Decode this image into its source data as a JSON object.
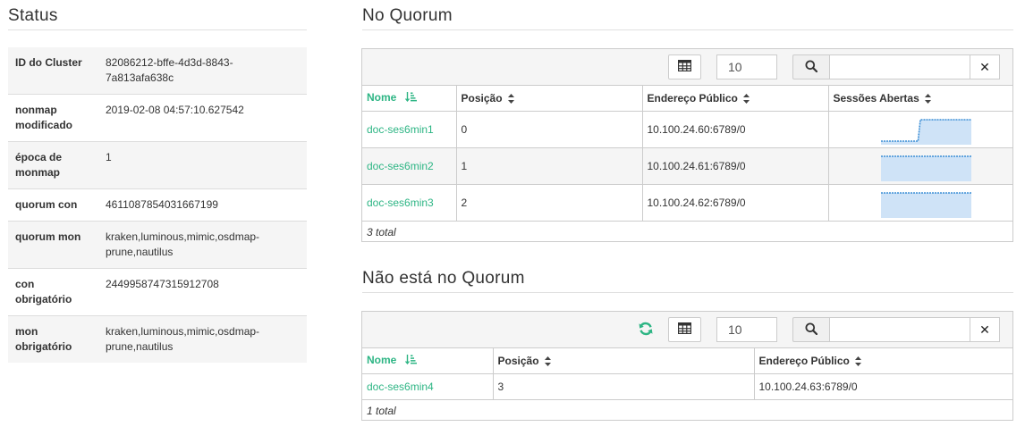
{
  "status": {
    "title": "Status",
    "rows": [
      {
        "key": "ID do Cluster",
        "value": "82086212-bffe-4d3d-8843-7a813afa638c"
      },
      {
        "key": "nonmap modificado",
        "value": "2019-02-08 04:57:10.627542"
      },
      {
        "key": "época de monmap",
        "value": "1"
      },
      {
        "key": "quorum con",
        "value": "4611087854031667199"
      },
      {
        "key": "quorum mon",
        "value": "kraken,luminous,mimic,osdmap-prune,nautilus"
      },
      {
        "key": "con obrigatório",
        "value": "2449958747315912708"
      },
      {
        "key": "mon obrigatório",
        "value": "kraken,luminous,mimic,osdmap-prune,nautilus"
      }
    ]
  },
  "in_quorum": {
    "title": "No Quorum",
    "page_size": "10",
    "search_value": "",
    "columns": [
      "Nome",
      "Posição",
      "Endereço Público",
      "Sessões Abertas"
    ],
    "rows": [
      {
        "name": "doc-ses6min1",
        "rank": "0",
        "addr": "10.100.24.60:6789/0",
        "sessions": [
          0,
          0,
          0,
          0,
          0,
          0,
          0,
          0,
          0,
          0,
          0,
          0,
          0,
          0,
          0,
          0,
          0,
          1,
          1,
          1,
          1,
          1,
          1,
          1,
          1,
          1,
          1,
          1,
          1,
          1,
          1,
          1,
          1,
          1,
          1,
          1,
          1,
          1,
          1,
          1
        ]
      },
      {
        "name": "doc-ses6min2",
        "rank": "1",
        "addr": "10.100.24.61:6789/0",
        "sessions": [
          1,
          1,
          1,
          1,
          1,
          1,
          1,
          1,
          1,
          1,
          1,
          1,
          1,
          1,
          1,
          1,
          1,
          1,
          1,
          1,
          1,
          1,
          1,
          1,
          1,
          1,
          1,
          1,
          1,
          1,
          1,
          1,
          1,
          1,
          1,
          1,
          1,
          1,
          1,
          1
        ]
      },
      {
        "name": "doc-ses6min3",
        "rank": "2",
        "addr": "10.100.24.62:6789/0",
        "sessions": [
          1,
          1,
          1,
          1,
          1,
          1,
          1,
          1,
          1,
          1,
          1,
          1,
          1,
          1,
          1,
          1,
          1,
          1,
          1,
          1,
          1,
          1,
          1,
          1,
          1,
          1,
          1,
          1,
          1,
          1,
          1,
          1,
          1,
          1,
          1,
          1,
          1,
          1,
          1,
          1
        ]
      }
    ],
    "footer": "3 total"
  },
  "out_quorum": {
    "title": "Não está no Quorum",
    "page_size": "10",
    "search_value": "",
    "columns": [
      "Nome",
      "Posição",
      "Endereço Público"
    ],
    "rows": [
      {
        "name": "doc-ses6min4",
        "rank": "3",
        "addr": "10.100.24.63:6789/0"
      }
    ],
    "footer": "1 total"
  },
  "colors": {
    "accent": "#2db584",
    "spark_line": "#3d8fd6",
    "spark_fill": "#cfe3f7"
  },
  "icons": {
    "columns": "table-grid-icon",
    "search": "magnifier-icon",
    "clear": "close-x-icon",
    "refresh": "refresh-icon",
    "sort_active": "sort-amount-asc-icon",
    "sort": "sort-updown-icon"
  }
}
